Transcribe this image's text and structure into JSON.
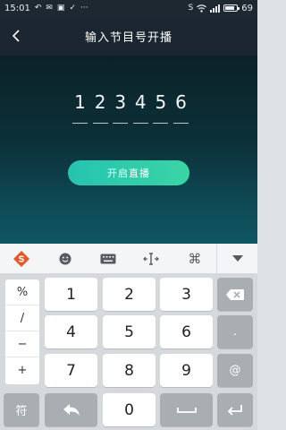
{
  "status_bar": {
    "time": "15:01",
    "battery_level": "69"
  },
  "header": {
    "title": "输入节目号开播",
    "back_icon": "back-chevron-icon"
  },
  "program_number": {
    "digits": [
      "1",
      "2",
      "3",
      "4",
      "5",
      "6"
    ]
  },
  "start_button": {
    "label": "开启直播"
  },
  "keyboard": {
    "toolbar": {
      "items": [
        "sogou-logo-icon",
        "emoji-icon",
        "keyboard-icon",
        "cursor-move-icon",
        "command-icon",
        "collapse-icon"
      ]
    },
    "symbols": [
      "%",
      "/",
      "−",
      "+"
    ],
    "digit_keys": [
      [
        "1",
        "2",
        "3"
      ],
      [
        "4",
        "5",
        "6"
      ],
      [
        "7",
        "8",
        "9"
      ]
    ],
    "zero": "0",
    "dot": ".",
    "at": "@",
    "symbol_toggle": "符",
    "accent_color": "#2fcdac"
  }
}
